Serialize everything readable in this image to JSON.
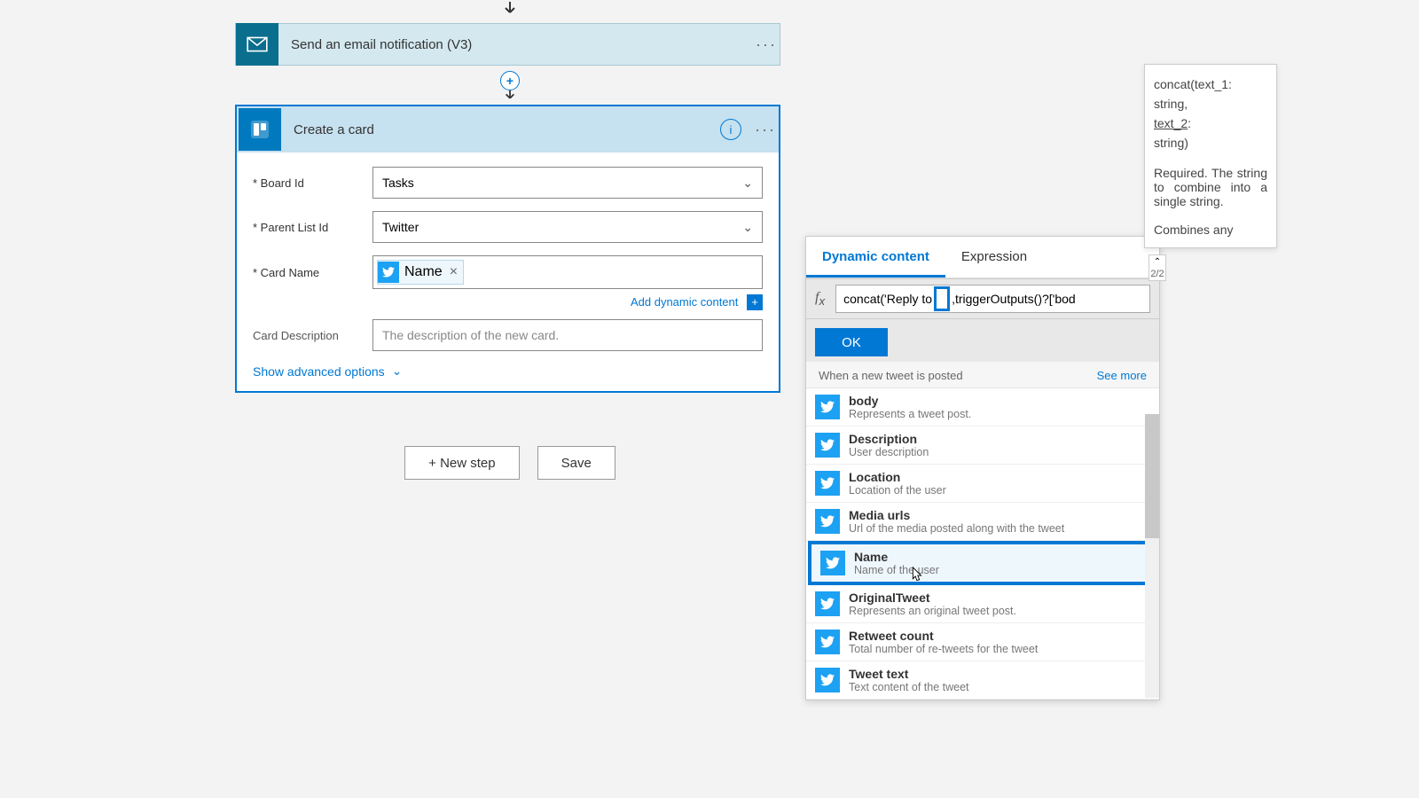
{
  "email_step": {
    "title": "Send an email notification (V3)"
  },
  "card_step": {
    "title": "Create a card",
    "fields": {
      "board_label": "* Board Id",
      "board_value": "Tasks",
      "list_label": "* Parent List Id",
      "list_value": "Twitter",
      "name_label": "* Card Name",
      "chip_label": "Name",
      "dyn_link": "Add dynamic content",
      "desc_label": "Card Description",
      "desc_placeholder": "The description of the new card.",
      "adv": "Show advanced options"
    }
  },
  "buttons": {
    "new_step": "+ New step",
    "save": "Save"
  },
  "dynamic": {
    "tab1": "Dynamic content",
    "tab2": "Expression",
    "formula_left": "concat('Reply to ",
    "formula_right": ",triggerOutputs()?['bod",
    "ok": "OK",
    "section_title": "When a new tweet is posted",
    "see_more": "See more",
    "step_count": "2/2",
    "items": [
      {
        "name": "body",
        "desc": "Represents a tweet post."
      },
      {
        "name": "Description",
        "desc": "User description"
      },
      {
        "name": "Location",
        "desc": "Location of the user"
      },
      {
        "name": "Media urls",
        "desc": "Url of the media posted along with the tweet"
      },
      {
        "name": "Name",
        "desc": "Name of the user"
      },
      {
        "name": "OriginalTweet",
        "desc": "Represents an original tweet post."
      },
      {
        "name": "Retweet count",
        "desc": "Total number of re-tweets for the tweet"
      },
      {
        "name": "Tweet text",
        "desc": "Text content of the tweet"
      }
    ]
  },
  "tooltip": {
    "sig1": "concat(text_1:",
    "sig2": "string,",
    "sig3": "text_2",
    "sig4": ":",
    "sig5": "string)",
    "body1": "Required. The string to combine into a single string.",
    "body2": "Combines any"
  }
}
